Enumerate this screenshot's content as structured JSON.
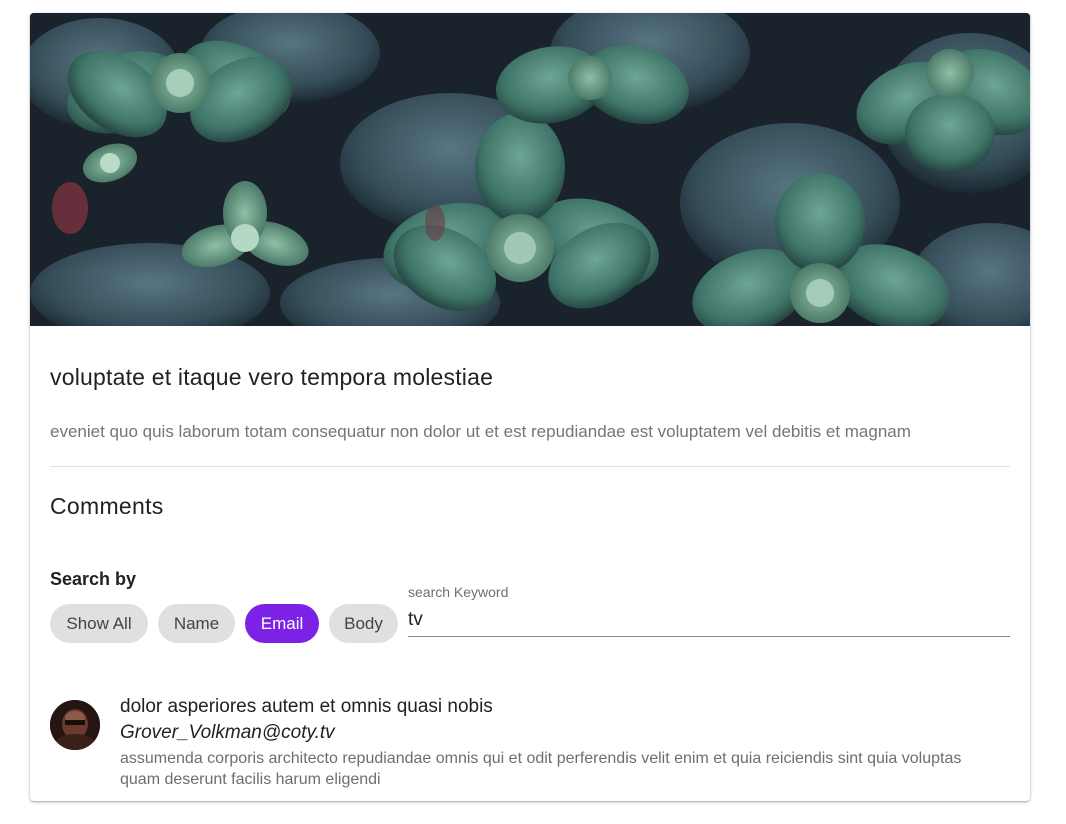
{
  "post": {
    "title": "voluptate et itaque vero tempora molestiae",
    "body": "eveniet quo quis laborum totam consequatur non dolor ut et est repudiandae est voluptatem vel debitis et magnam",
    "hero_image": "succulent-plants-photo"
  },
  "comments_section": {
    "title": "Comments",
    "search_label": "Search by",
    "filters": {
      "show_all": "Show All",
      "name": "Name",
      "email": "Email",
      "body": "Body"
    },
    "active_filter": "Email",
    "search": {
      "label": "search Keyword",
      "value": "tv"
    }
  },
  "comments": [
    {
      "name": "dolor asperiores autem et omnis quasi nobis",
      "email": "Grover_Volkman@coty.tv",
      "body": "assumenda corporis architecto repudiandae omnis qui et odit perferendis velit enim et quia reiciendis sint quia voluptas quam deserunt facilis harum eligendi",
      "avatar": "user-avatar"
    }
  ],
  "colors": {
    "accent": "#7b22e6",
    "chip": "#e0e0e0",
    "text": "#222222",
    "muted": "#757575"
  }
}
